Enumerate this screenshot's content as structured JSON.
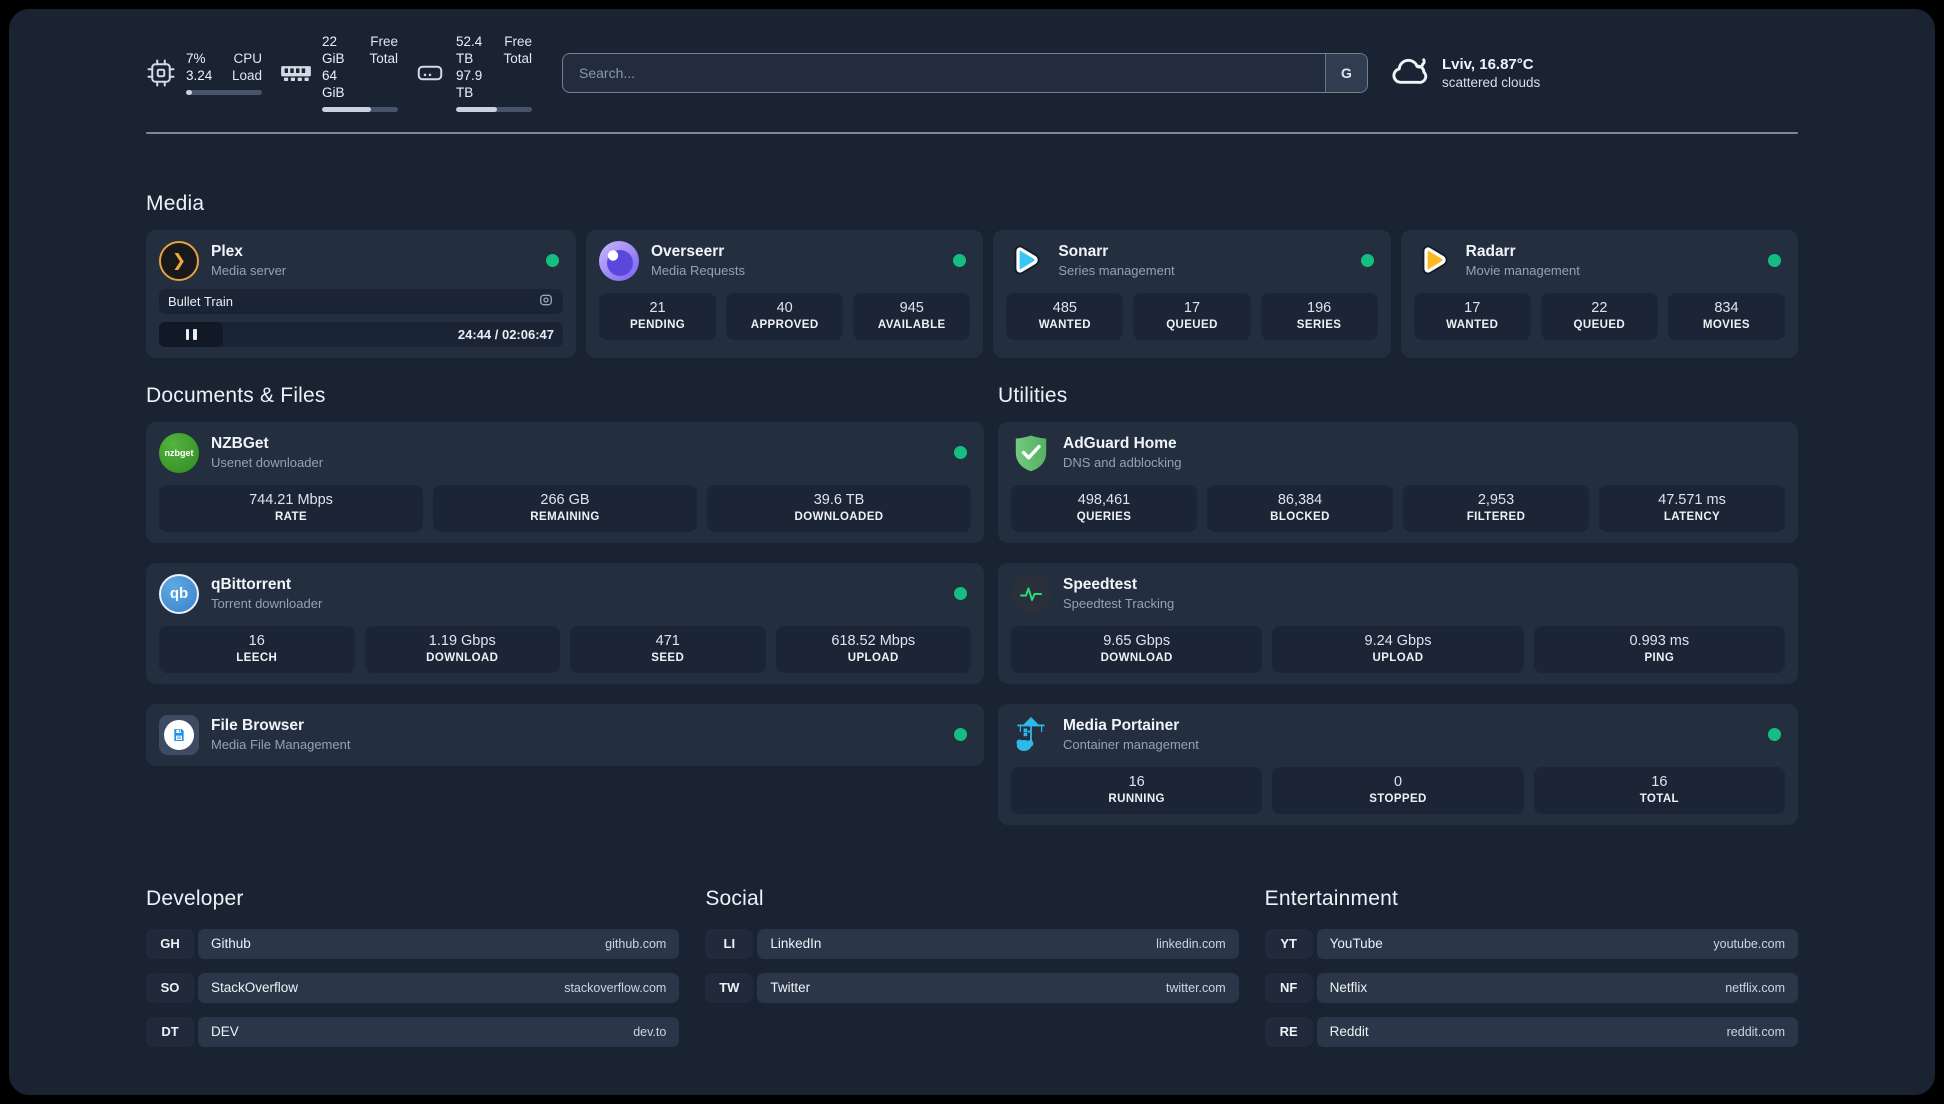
{
  "header": {
    "stats": [
      {
        "icon": "cpu-icon",
        "value_top": "7%",
        "value_bottom": "3.24",
        "label_top": "CPU",
        "label_bottom": "Load",
        "progress": 8
      },
      {
        "icon": "ram-icon",
        "value_top": "22 GiB",
        "value_bottom": "64 GiB",
        "label_top": "Free",
        "label_bottom": "Total",
        "progress": 65
      },
      {
        "icon": "disk-icon",
        "value_top": "52.4 TB",
        "value_bottom": "97.9 TB",
        "label_top": "Free",
        "label_bottom": "Total",
        "progress": 54
      }
    ],
    "search": {
      "placeholder": "Search...",
      "button": "G"
    },
    "weather": {
      "location": "Lviv, 16.87°C",
      "condition": "scattered clouds"
    }
  },
  "sections": {
    "media": "Media",
    "documents": "Documents & Files",
    "utilities": "Utilities"
  },
  "apps": {
    "plex": {
      "name": "Plex",
      "subtitle": "Media server",
      "icon_glyph": "❯",
      "now_playing": {
        "title": "Bullet Train",
        "time": "24:44 / 02:06:47"
      }
    },
    "overseerr": {
      "name": "Overseerr",
      "subtitle": "Media Requests",
      "stats": [
        {
          "value": "21",
          "label": "PENDING"
        },
        {
          "value": "40",
          "label": "APPROVED"
        },
        {
          "value": "945",
          "label": "AVAILABLE"
        }
      ]
    },
    "sonarr": {
      "name": "Sonarr",
      "subtitle": "Series management",
      "stats": [
        {
          "value": "485",
          "label": "WANTED"
        },
        {
          "value": "17",
          "label": "QUEUED"
        },
        {
          "value": "196",
          "label": "SERIES"
        }
      ]
    },
    "radarr": {
      "name": "Radarr",
      "subtitle": "Movie management",
      "stats": [
        {
          "value": "17",
          "label": "WANTED"
        },
        {
          "value": "22",
          "label": "QUEUED"
        },
        {
          "value": "834",
          "label": "MOVIES"
        }
      ]
    },
    "nzbget": {
      "name": "NZBGet",
      "subtitle": "Usenet downloader",
      "icon_text": "nzbget",
      "stats": [
        {
          "value": "744.21 Mbps",
          "label": "RATE"
        },
        {
          "value": "266 GB",
          "label": "REMAINING"
        },
        {
          "value": "39.6 TB",
          "label": "DOWNLOADED"
        }
      ]
    },
    "qbittorrent": {
      "name": "qBittorrent",
      "subtitle": "Torrent downloader",
      "icon_text": "qb",
      "stats": [
        {
          "value": "16",
          "label": "LEECH"
        },
        {
          "value": "1.19 Gbps",
          "label": "DOWNLOAD"
        },
        {
          "value": "471",
          "label": "SEED"
        },
        {
          "value": "618.52 Mbps",
          "label": "UPLOAD"
        }
      ]
    },
    "filebrowser": {
      "name": "File Browser",
      "subtitle": "Media File Management"
    },
    "adguard": {
      "name": "AdGuard Home",
      "subtitle": "DNS and adblocking",
      "stats": [
        {
          "value": "498,461",
          "label": "QUERIES"
        },
        {
          "value": "86,384",
          "label": "BLOCKED"
        },
        {
          "value": "2,953",
          "label": "FILTERED"
        },
        {
          "value": "47.571 ms",
          "label": "LATENCY"
        }
      ]
    },
    "speedtest": {
      "name": "Speedtest",
      "subtitle": "Speedtest Tracking",
      "stats": [
        {
          "value": "9.65 Gbps",
          "label": "DOWNLOAD"
        },
        {
          "value": "9.24 Gbps",
          "label": "UPLOAD"
        },
        {
          "value": "0.993 ms",
          "label": "PING"
        }
      ]
    },
    "portainer": {
      "name": "Media Portainer",
      "subtitle": "Container management",
      "stats": [
        {
          "value": "16",
          "label": "RUNNING"
        },
        {
          "value": "0",
          "label": "STOPPED"
        },
        {
          "value": "16",
          "label": "TOTAL"
        }
      ]
    }
  },
  "links": {
    "developer": {
      "title": "Developer",
      "items": [
        {
          "tag": "GH",
          "name": "Github",
          "url": "github.com"
        },
        {
          "tag": "SO",
          "name": "StackOverflow",
          "url": "stackoverflow.com"
        },
        {
          "tag": "DT",
          "name": "DEV",
          "url": "dev.to"
        }
      ]
    },
    "social": {
      "title": "Social",
      "items": [
        {
          "tag": "LI",
          "name": "LinkedIn",
          "url": "linkedin.com"
        },
        {
          "tag": "TW",
          "name": "Twitter",
          "url": "twitter.com"
        }
      ]
    },
    "entertainment": {
      "title": "Entertainment",
      "items": [
        {
          "tag": "YT",
          "name": "YouTube",
          "url": "youtube.com"
        },
        {
          "tag": "NF",
          "name": "Netflix",
          "url": "netflix.com"
        },
        {
          "tag": "RE",
          "name": "Reddit",
          "url": "reddit.com"
        }
      ]
    }
  },
  "colors": {
    "status_online": "#15bd80",
    "card": "#232e3f",
    "background": "#1a2332"
  }
}
